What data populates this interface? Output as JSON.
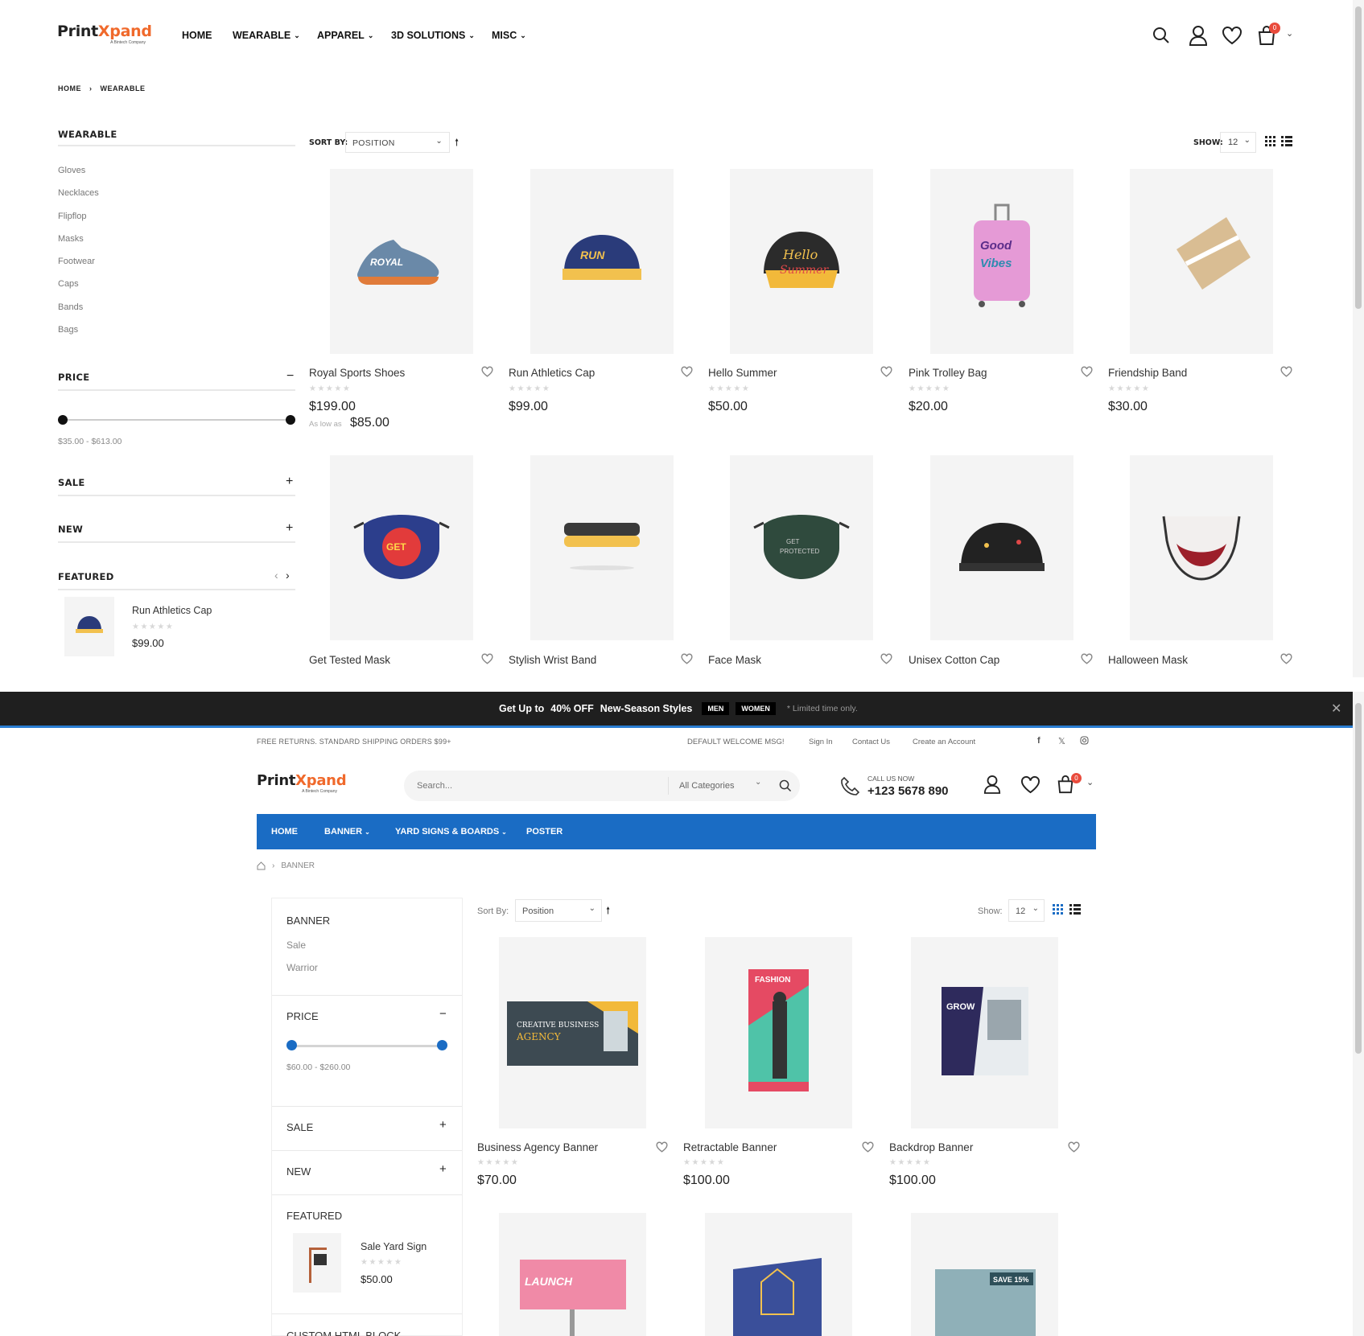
{
  "site1": {
    "logo_text": "Print",
    "logo_x": "Xpand",
    "logo_tagline": "A Bintech Company",
    "nav": [
      "HOME",
      "WEARABLE",
      "APPAREL",
      "3D SOLUTIONS",
      "MISC"
    ],
    "cart_count": "0",
    "breadcrumb": [
      "HOME",
      "WEARABLE"
    ],
    "sidebar": {
      "category_title": "WEARABLE",
      "categories": [
        "Gloves",
        "Necklaces",
        "Flipflop",
        "Masks",
        "Footwear",
        "Caps",
        "Bands",
        "Bags"
      ],
      "price_title": "PRICE",
      "price_range": "$35.00 - $613.00",
      "sale_title": "SALE",
      "new_title": "NEW",
      "featured_title": "FEATURED",
      "featured_item": {
        "name": "Run Athletics Cap",
        "price": "$99.00"
      }
    },
    "toolbar": {
      "sort_label": "SORT BY:",
      "sort_value": "POSITION",
      "show_label": "SHOW:",
      "show_value": "12"
    },
    "products_row1": [
      {
        "name": "Royal Sports Shoes",
        "price": "$199.00",
        "as_low_label": "As low as",
        "as_low_price": "$85.00"
      },
      {
        "name": "Run Athletics Cap",
        "price": "$99.00"
      },
      {
        "name": "Hello Summer",
        "price": "$50.00"
      },
      {
        "name": "Pink Trolley Bag",
        "price": "$20.00"
      },
      {
        "name": "Friendship Band",
        "price": "$30.00"
      }
    ],
    "products_row2": [
      {
        "name": "Get Tested Mask"
      },
      {
        "name": "Stylish Wrist Band"
      },
      {
        "name": "Face Mask"
      },
      {
        "name": "Unisex Cotton Cap"
      },
      {
        "name": "Halloween Mask"
      }
    ]
  },
  "promo": {
    "text_pre": "Get Up to",
    "text_bold": "40% OFF",
    "text_post": "New-Season Styles",
    "men": "MEN",
    "women": "WOMEN",
    "limited": "* Limited time only."
  },
  "site2": {
    "topbar": {
      "left": "FREE RETURNS. STANDARD SHIPPING ORDERS $99+",
      "welcome": "DEFAULT WELCOME MSG!",
      "links": [
        "Sign In",
        "Contact Us",
        "Create an Account"
      ]
    },
    "logo_text": "Print",
    "logo_x": "Xpand",
    "logo_tagline": "A Bintech Company",
    "search_placeholder": "Search...",
    "categories_select": "All Categories",
    "call_label": "CALL US NOW",
    "phone": "+123 5678 890",
    "cart_count": "0",
    "nav": [
      "HOME",
      "BANNER",
      "YARD SIGNS & BOARDS",
      "POSTER"
    ],
    "breadcrumb": "BANNER",
    "sidebar": {
      "category_title": "BANNER",
      "categories": [
        "Sale",
        "Warrior"
      ],
      "price_title": "PRICE",
      "price_range": "$60.00 - $260.00",
      "sale_title": "SALE",
      "new_title": "NEW",
      "featured_title": "FEATURED",
      "featured_item": {
        "name": "Sale Yard Sign",
        "price": "$50.00"
      },
      "custom_block": "CUSTOM HTML BLOCK"
    },
    "toolbar": {
      "sort_label": "Sort By:",
      "sort_value": "Position",
      "show_label": "Show:",
      "show_value": "12"
    },
    "products": [
      {
        "name": "Business Agency Banner",
        "price": "$70.00"
      },
      {
        "name": "Retractable Banner",
        "price": "$100.00"
      },
      {
        "name": "Backdrop Banner",
        "price": "$100.00"
      }
    ]
  },
  "colors": {
    "accent_orange": "#f0692b",
    "nav_blue": "#1a6cc4",
    "promo_bg": "#1f1f1f",
    "badge_red": "#e94b3c"
  }
}
